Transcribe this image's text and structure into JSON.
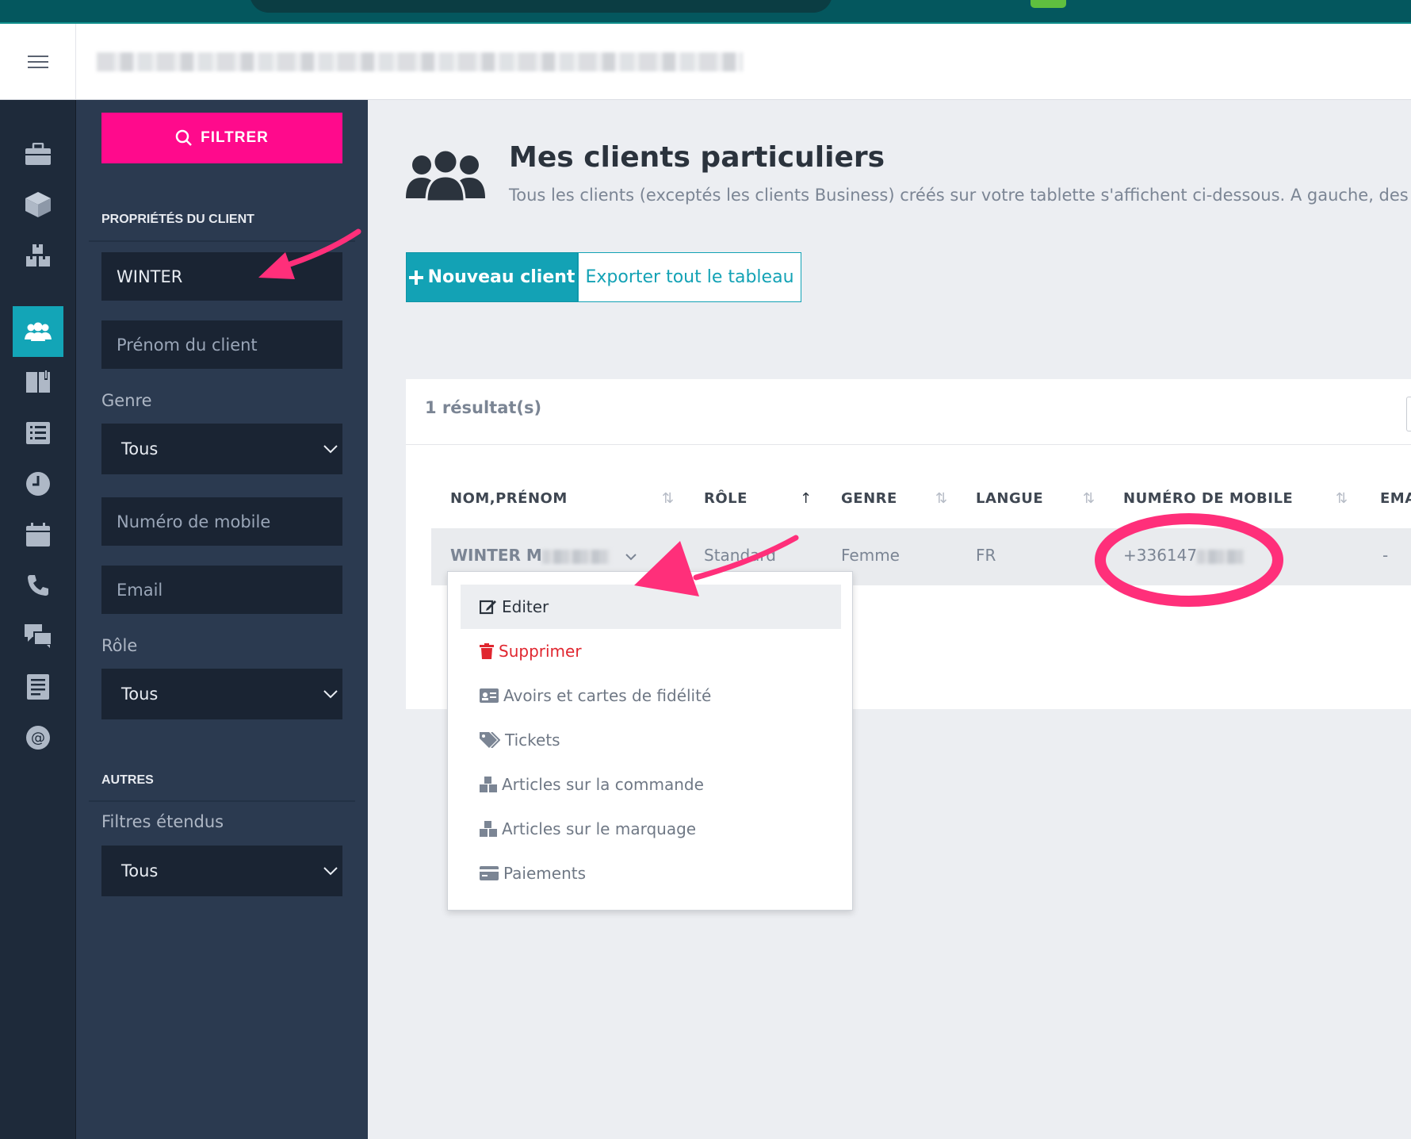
{
  "filters": {
    "filter_button": "FILTRER",
    "section_client": "PROPRIÉTÉS DU CLIENT",
    "name_value": "WINTER",
    "firstname_placeholder": "Prénom du client",
    "genre_label": "Genre",
    "genre_value": "Tous",
    "mobile_placeholder": "Numéro de mobile",
    "email_placeholder": "Email",
    "role_label": "Rôle",
    "role_value": "Tous",
    "section_other": "AUTRES",
    "extended_label": "Filtres étendus",
    "extended_value": "Tous"
  },
  "page": {
    "title": "Mes clients particuliers",
    "subtitle": "Tous les clients (exceptés les clients Business) créés sur votre tablette s'affichent ci-dessous. A gauche, des filtre",
    "new_client": "Nouveau client",
    "export_all": "Exporter tout le tableau"
  },
  "table": {
    "result_count": "1 résultat(s)",
    "columns": [
      "NOM,PRÉNOM",
      "RÔLE",
      "GENRE",
      "LANGUE",
      "NUMÉRO DE MOBILE",
      "EMA"
    ],
    "row": {
      "name": "WINTER M",
      "role": "Standard",
      "genre": "Femme",
      "langue": "FR",
      "mobile": "+336147",
      "email": "-"
    }
  },
  "menu": {
    "items": [
      "Editer",
      "Supprimer",
      "Avoirs et cartes de fidélité",
      "Tickets",
      "Articles sur la commande",
      "Articles sur le marquage",
      "Paiements"
    ]
  },
  "colors": {
    "accent": "#13a2b5",
    "brand_pink": "#ff0a8c",
    "sidebar": "#2b3a50",
    "annotation": "#ff2f7a"
  },
  "icons": [
    "menu-icon",
    "briefcase-icon",
    "box-icon",
    "boxes-icon",
    "users-icon",
    "book-icon",
    "list-icon",
    "clock-icon",
    "calendar-icon",
    "phone-icon",
    "chat-icon",
    "document-icon",
    "at-icon",
    "search-icon",
    "plus-icon",
    "chevron-down-icon",
    "edit-icon",
    "trash-icon",
    "id-card-icon",
    "tags-icon",
    "cubes-icon",
    "credit-card-icon"
  ]
}
